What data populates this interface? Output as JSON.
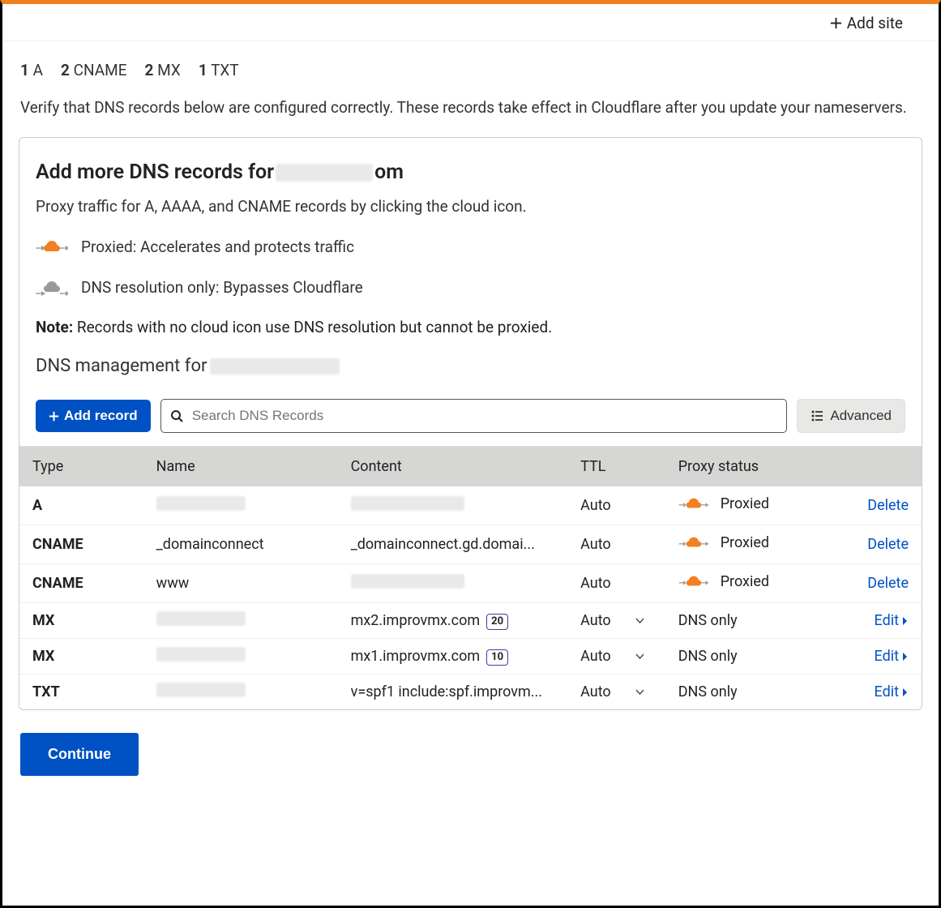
{
  "topbar": {
    "add_site": "Add site"
  },
  "counts": [
    {
      "n": "1",
      "label": "A"
    },
    {
      "n": "2",
      "label": "CNAME"
    },
    {
      "n": "2",
      "label": "MX"
    },
    {
      "n": "1",
      "label": "TXT"
    }
  ],
  "verify_text": "Verify that DNS records below are configured correctly. These records take effect in Cloudflare after you update your nameservers.",
  "panel": {
    "heading_prefix": "Add more DNS records for ",
    "heading_suffix": "om",
    "desc": "Proxy traffic for A, AAAA, and CNAME records by clicking the cloud icon.",
    "legend_proxied": "Proxied: Accelerates and protects traffic",
    "legend_dns": "DNS resolution only: Bypasses Cloudflare",
    "note_label": "Note:",
    "note_text": " Records with no cloud icon use DNS resolution but cannot be proxied.",
    "mgmt_prefix": "DNS management for "
  },
  "toolbar": {
    "add_record": "Add record",
    "search_placeholder": "Search DNS Records",
    "advanced": "Advanced"
  },
  "table": {
    "headers": {
      "type": "Type",
      "name": "Name",
      "content": "Content",
      "ttl": "TTL",
      "proxy": "Proxy status"
    },
    "rows": [
      {
        "type": "A",
        "name_blur": true,
        "name": "",
        "content_blur": true,
        "content": "",
        "priority": "",
        "ttl": "Auto",
        "ttl_dropdown": false,
        "proxy": "Proxied",
        "proxy_icon": "orange",
        "action": "Delete"
      },
      {
        "type": "CNAME",
        "name_blur": false,
        "name": "_domainconnect",
        "content_blur": false,
        "content": "_domainconnect.gd.domai...",
        "priority": "",
        "ttl": "Auto",
        "ttl_dropdown": false,
        "proxy": "Proxied",
        "proxy_icon": "orange",
        "action": "Delete"
      },
      {
        "type": "CNAME",
        "name_blur": false,
        "name": "www",
        "content_blur": true,
        "content": "",
        "priority": "",
        "ttl": "Auto",
        "ttl_dropdown": false,
        "proxy": "Proxied",
        "proxy_icon": "orange",
        "action": "Delete"
      },
      {
        "type": "MX",
        "name_blur": true,
        "name": "",
        "content_blur": false,
        "content": "mx2.improvmx.com",
        "priority": "20",
        "ttl": "Auto",
        "ttl_dropdown": true,
        "proxy": "DNS only",
        "proxy_icon": "",
        "action": "Edit"
      },
      {
        "type": "MX",
        "name_blur": true,
        "name": "",
        "content_blur": false,
        "content": "mx1.improvmx.com",
        "priority": "10",
        "ttl": "Auto",
        "ttl_dropdown": true,
        "proxy": "DNS only",
        "proxy_icon": "",
        "action": "Edit"
      },
      {
        "type": "TXT",
        "name_blur": true,
        "name": "",
        "content_blur": false,
        "content": "v=spf1 include:spf.improvm...",
        "priority": "",
        "ttl": "Auto",
        "ttl_dropdown": true,
        "proxy": "DNS only",
        "proxy_icon": "",
        "action": "Edit"
      }
    ]
  },
  "continue": "Continue"
}
